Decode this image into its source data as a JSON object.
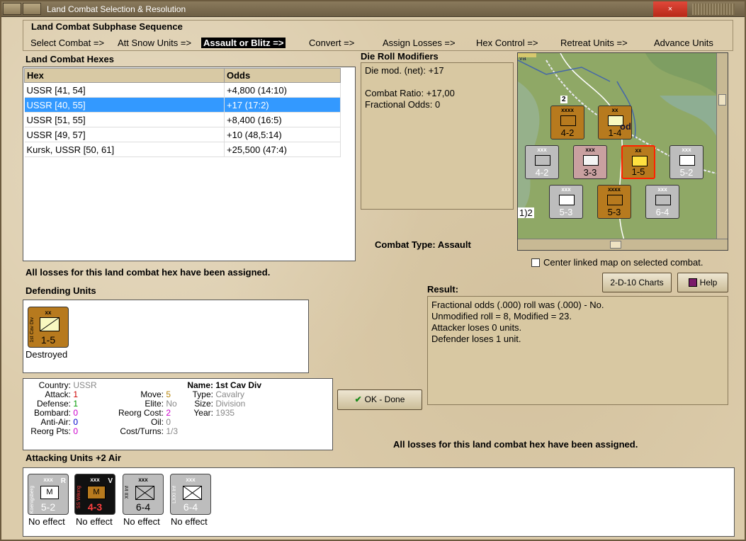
{
  "window": {
    "title": "Land Combat Selection & Resolution",
    "close_glyph": "×"
  },
  "sequence": {
    "title": "Land Combat Subphase Sequence",
    "steps": [
      "Select Combat =>",
      "Att Snow Units =>",
      "Assault or Blitz =>",
      "Convert =>",
      "Assign Losses =>",
      "Hex Control =>",
      "Retreat Units =>",
      "Advance Units"
    ],
    "active_index": 2
  },
  "hexes": {
    "title": "Land Combat Hexes",
    "columns": [
      "Hex",
      "Odds"
    ],
    "rows": [
      {
        "hex": "USSR [41, 54]",
        "odds": "+4,800 (14:10)"
      },
      {
        "hex": "USSR [40, 55]",
        "odds": "+17 (17:2)"
      },
      {
        "hex": "USSR [51, 55]",
        "odds": "+8,400 (16:5)"
      },
      {
        "hex": "USSR [49, 57]",
        "odds": "+10 (48,5:14)"
      },
      {
        "hex": "Kursk, USSR [50, 61]",
        "odds": "+25,500 (47:4)"
      }
    ],
    "selected_index": 1
  },
  "die_roll": {
    "title": "Die Roll Modifiers",
    "net": "Die mod. (net): +17",
    "ratio": "Combat Ratio: +17,00",
    "fractional": "Fractional Odds: 0"
  },
  "combat_type": "Combat Type:  Assault",
  "center_map_label": "Center linked map on selected combat.",
  "buttons": {
    "charts": "2-D-10 Charts",
    "help": "Help",
    "ok": "OK - Done"
  },
  "losses_message": "All losses for this land combat hex have been assigned.",
  "result": {
    "title": "Result:",
    "lines": [
      "Fractional odds (.000) roll was (.000)  - No.",
      "Unmodified roll = 8, Modified = 23.",
      "Attacker loses 0 units.",
      "Defender loses 1 unit."
    ]
  },
  "defending": {
    "title": "Defending Units",
    "unit": {
      "size": "xx",
      "side_text": "1st Cav Div",
      "strength": "1-5",
      "status": "Destroyed"
    }
  },
  "stats": {
    "country_label": "Country:",
    "country": "USSR",
    "attack_label": "Attack:",
    "attack": "1",
    "defense_label": "Defense:",
    "defense": "1",
    "bombard_label": "Bombard:",
    "bombard": "0",
    "antiair_label": "Anti-Air:",
    "antiair": "0",
    "reorg_pts_label": "Reorg Pts:",
    "reorg_pts": "0",
    "move_label": "Move:",
    "move": "5",
    "elite_label": "Elite:",
    "elite": "No",
    "reorg_cost_label": "Reorg Cost:",
    "reorg_cost": "2",
    "oil_label": "Oil:",
    "oil": "0",
    "cost_turns_label": "Cost/Turns:",
    "cost_turns": "1/3",
    "name_label": "Name:",
    "name": "1st Cav Div",
    "type_label": "Type:",
    "type": "Cavalry",
    "size_label": "Size:",
    "size": "Division",
    "year_label": "Year:",
    "year": "1935"
  },
  "attacking": {
    "title": "Attacking Units +2 Air",
    "units": [
      {
        "size": "xxx",
        "side_text": "Koenigsberg",
        "tag": "R",
        "strength": "5-2",
        "status": "No effect",
        "mech": "M",
        "color": "#bdbdbd"
      },
      {
        "size": "xxx",
        "side_text": "SS Wiking",
        "tag": "V",
        "strength": "4-3",
        "status": "No effect",
        "mech": "M",
        "color": "#111111"
      },
      {
        "size": "xxx",
        "side_text": "XII Inf",
        "tag": "",
        "strength": "6-4",
        "status": "No effect",
        "mech": "",
        "color": "#bdbdbd"
      },
      {
        "size": "xxx",
        "side_text": "LXXI Inf",
        "tag": "",
        "strength": "6-4",
        "status": "No effect",
        "mech": "",
        "color": "#bdbdbd"
      }
    ]
  },
  "map": {
    "counters": [
      {
        "size": "xxxx",
        "strength": "4-2",
        "mech": "M",
        "style": "tan"
      },
      {
        "size": "xx",
        "strength": "1-4",
        "mech": "",
        "style": "tan"
      },
      {
        "size": "xxx",
        "strength": "4-2",
        "mech": "M",
        "style": "gray"
      },
      {
        "size": "xxx",
        "strength": "3-3",
        "mech": "M",
        "style": "pink"
      },
      {
        "size": "xx",
        "strength": "1-5",
        "mech": "",
        "style": "tan"
      },
      {
        "size": "xxx",
        "strength": "5-2",
        "mech": "M",
        "style": "gray"
      },
      {
        "size": "xxx",
        "strength": "5-3",
        "mech": "",
        "style": "gray"
      },
      {
        "size": "xxxx",
        "strength": "5-3",
        "mech": "",
        "style": "tan"
      },
      {
        "size": "xxx",
        "strength": "6-4",
        "mech": "",
        "style": "gray"
      }
    ],
    "town_text": "od",
    "stack_badge": "2",
    "edge_text": "1)2"
  },
  "colors": {
    "selected_row": "#3399ff",
    "active_step_bg": "#000000",
    "attack_value": "#cc0000",
    "defense_value": "#009900",
    "bombard_value": "#cc00cc",
    "antiair_value": "#0000cc"
  }
}
